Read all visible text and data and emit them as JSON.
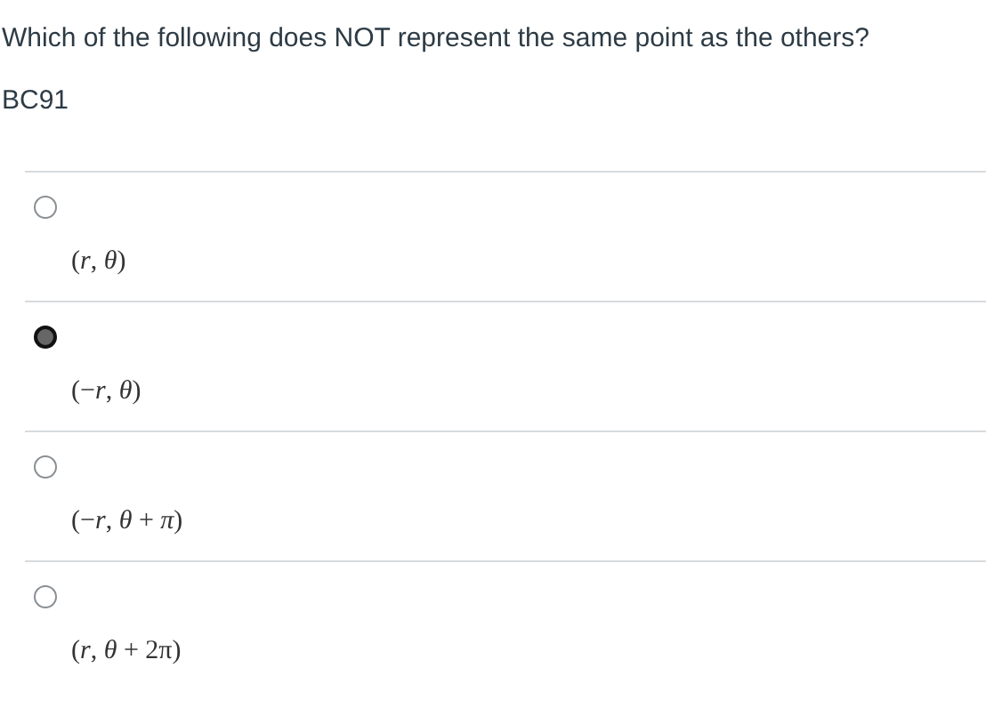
{
  "question": "Which of the following does NOT represent the same point as the others?",
  "code": "BC91",
  "options": [
    {
      "label": "(*r*, *θ*)",
      "selected": false
    },
    {
      "label": "(−*r*, *θ*)",
      "selected": true
    },
    {
      "label": "(−*r*, *θ* + *π*)",
      "selected": false
    },
    {
      "label": "(*r*, *θ* + 2π)",
      "selected": false
    }
  ]
}
